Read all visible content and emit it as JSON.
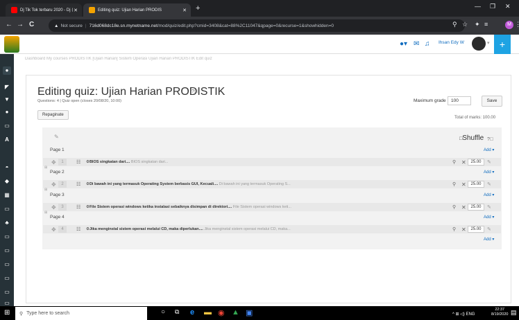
{
  "browser": {
    "tabs": [
      {
        "label": "Dj Tik Tok terbaru 2020 - Dj ⟨",
        "active": false
      },
      {
        "label": "Editing quiz: Ujian Harian PRODIS",
        "active": true
      }
    ],
    "new_tab": "+",
    "window_controls": [
      "—",
      "❐",
      "✕"
    ],
    "nav": [
      "←",
      "→",
      "C"
    ],
    "security": "Not secure",
    "url_host": "716d068dc18e.sn.mynetname.net",
    "url_path": "/mod/quiz/edit.php?cmid=3408&cat=88%2C11047&qpage=0&recurse=1&showhidden=0",
    "profile_initial": "M"
  },
  "moodle": {
    "user_name": "Ihsan Edy W",
    "breadcrumb": "Dashboard   My courses   PRODISTIK   [Ujian Harian] Sistem Operasi   Ujian Harian PRODISTIK   Edit quiz"
  },
  "quiz": {
    "title": "Editing quiz: Ujian Harian PRODISTIK",
    "info": "Questions: 4 | Quiz open (closes 20/08/20, 10:00)",
    "repaginate": "Repaginate",
    "max_grade_label": "Maximum grade",
    "max_grade_value": "100",
    "save": "Save",
    "total_marks": "Total of marks: 100.00",
    "shuffle": "Shuffle",
    "add": "Add",
    "pages": [
      {
        "label": "Page 1"
      },
      {
        "label": "Page 2"
      },
      {
        "label": "Page 3"
      },
      {
        "label": "Page 4"
      }
    ],
    "questions": [
      {
        "num": "1",
        "title": "BIOS singkatan dari....",
        "preview": "BIOS singkatan dari...",
        "mark": "25.00"
      },
      {
        "num": "2",
        "title": "Di bawah ini yang termasuk Operating System berbasis GUI, Kecuali....",
        "preview": "Di bawah ini yang termasuk Operating S...",
        "mark": "25.00"
      },
      {
        "num": "3",
        "title": "File Sistem operasi windows ketika instalasi sebaiknya disimpan di direktori....",
        "preview": "File Sistem operasi windows keti...",
        "mark": "25.00"
      },
      {
        "num": "4",
        "title": "Jika menginstal sistem operasi melalui CD, maka diperlukan....",
        "preview": "Jika menginstal sistem operasi melalui CD, maka...",
        "mark": "25.00"
      }
    ]
  },
  "taskbar": {
    "search_placeholder": "Type here to search",
    "tray": "^  ⊞  ◁)  ENG",
    "time": "22:37",
    "date": "8/19/2020"
  },
  "colors": {
    "accent": "#0f6cbf",
    "sidebar": "#263238",
    "plus_button": "#1ea3e3"
  }
}
